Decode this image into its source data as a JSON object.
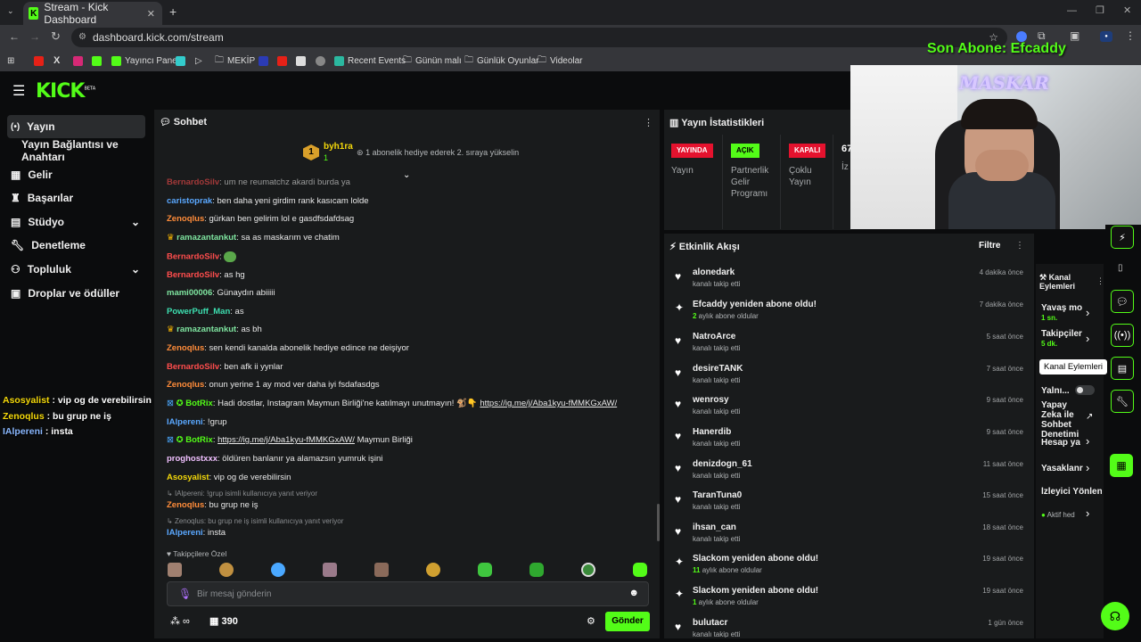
{
  "browser": {
    "tab_title": "Stream - Kick Dashboard",
    "url": "dashboard.kick.com/stream",
    "bookmarks": [
      "Yayıncı Paneli",
      "MEKİP",
      "Recent Events",
      "Günün malı",
      "Günlük Oyunlar",
      "Videolar"
    ]
  },
  "overlay": {
    "last_sub": "Son Abone: Efcaddy",
    "cam_name": "MASKAR",
    "chat": [
      {
        "user": "Asosyalist",
        "msg": " : vip og de verebilirsin"
      },
      {
        "user": "Zenoqlus",
        "msg": " : bu grup ne iş"
      },
      {
        "user": "IAlpereni",
        "msg": " : insta"
      }
    ]
  },
  "brand": {
    "logo": "KICK",
    "beta": "BETA"
  },
  "sidebar": {
    "items": [
      {
        "label": "Yayın"
      },
      {
        "label": "Yayın Bağlantısı ve Anahtarı"
      },
      {
        "label": "Gelir"
      },
      {
        "label": "Başarılar"
      },
      {
        "label": "Stüdyo"
      },
      {
        "label": "Denetleme"
      },
      {
        "label": "Topluluk"
      },
      {
        "label": "Droplar ve ödüller"
      }
    ]
  },
  "chat": {
    "title": "Sohbet",
    "top_user": "byh1ra",
    "top_rank": "1",
    "top_count": "1",
    "promo": "1 abonelik hediye ederek 2. sıraya yükselin",
    "cut_top": {
      "user": "BernardoSilv",
      "msg": ": um ne reumatchz akardi burda ya"
    },
    "messages": [
      {
        "user": "caristoprak",
        "msg": ": ben daha yeni girdim rank kasıcam lolde"
      },
      {
        "user": "Zenoqlus",
        "msg": ": gürkan ben gelirim lol e gasdfsdafdsag"
      },
      {
        "user": "ramazantankut",
        "msg": ": sa as maskarım ve chatim"
      },
      {
        "user": "BernardoSilv",
        "msg": ": "
      },
      {
        "user": "BernardoSilv",
        "msg": ": as hg"
      },
      {
        "user": "mami00006",
        "msg": ": Günaydın abiiiii"
      },
      {
        "user": "PowerPuff_Man",
        "msg": ": as"
      },
      {
        "user": "ramazantankut",
        "msg": ": as bh"
      },
      {
        "user": "Zenoqlus",
        "msg": ": sen kendi kanalda abonelik hediye edince ne deişiyor"
      },
      {
        "user": "BernardoSilv",
        "msg": ": ben afk ii yynlar"
      },
      {
        "user": "Zenoqlus",
        "msg": ": onun yerine 1 ay mod ver daha iyi fsdafasdgs"
      },
      {
        "user": "BotRix",
        "msg": ": Hadi dostlar, Instagram Maymun Birliği'ne katılmayı unutmayın! 🐒👇 ",
        "link": "https://ig.me/j/Aba1kyu-fMMKGxAW/"
      },
      {
        "user": "IAlpereni",
        "msg": ": !grup"
      },
      {
        "user": "BotRix",
        "msg": ": ",
        "link": "https://ig.me/j/Aba1kyu-fMMKGxAW/",
        "after": " Maymun Birliği"
      },
      {
        "user": "proghostxxx",
        "msg": ": öldüren banlanır ya alamazsın yumruk işini"
      },
      {
        "user": "Asosyalist",
        "msg": ": vip og de verebilirsin"
      },
      {
        "reply": "IAlpereni: !grup isimli kullanıcıya yanıt veriyor",
        "user": "Zenoqlus",
        "msg": ": bu grup ne iş"
      },
      {
        "reply": "Zenoqlus: bu grup ne iş isimli kullanıcıya yanıt veriyor",
        "user": "IAlpereni",
        "msg": ": insta"
      }
    ],
    "emote_section": "Takipçilere Özel",
    "input_placeholder": "Bir mesaj gönderin",
    "points_value": "390",
    "send_label": "Gönder"
  },
  "stats": {
    "title": "Yayın İstatistikleri",
    "items": [
      {
        "badge": "YAYINDA",
        "label": "Yayın",
        "color": "#e5122e"
      },
      {
        "badge": "AÇIK",
        "label": "Partnerlik Gelir Programı",
        "color": "#53fc18"
      },
      {
        "badge": "KAPALI",
        "label": "Çoklu Yayın",
        "color": "#e5122e"
      }
    ],
    "partial_value": "67",
    "partial_label": "İz"
  },
  "events": {
    "title": "Etkinlik Akışı",
    "filter": "Filtre",
    "items": [
      {
        "name": "alonedark",
        "sub": "kanalı takip etti",
        "time": "4 dakika önce",
        "type": "follow"
      },
      {
        "name": "Efcaddy yeniden abone oldu!",
        "sub_n": "2",
        "sub": " aylık abone oldular",
        "time": "7 dakika önce",
        "type": "sub"
      },
      {
        "name": "NatroArce",
        "sub": "kanalı takip etti",
        "time": "5 saat önce",
        "type": "follow"
      },
      {
        "name": "desireTANK",
        "sub": "kanalı takip etti",
        "time": "7 saat önce",
        "type": "follow"
      },
      {
        "name": "wenrosy",
        "sub": "kanalı takip etti",
        "time": "9 saat önce",
        "type": "follow"
      },
      {
        "name": "Hanerdib",
        "sub": "kanalı takip etti",
        "time": "9 saat önce",
        "type": "follow"
      },
      {
        "name": "denizdogn_61",
        "sub": "kanalı takip etti",
        "time": "11 saat önce",
        "type": "follow"
      },
      {
        "name": "TaranTuna0",
        "sub": "kanalı takip etti",
        "time": "15 saat önce",
        "type": "follow"
      },
      {
        "name": "ihsan_can",
        "sub": "kanalı takip etti",
        "time": "18 saat önce",
        "type": "follow"
      },
      {
        "name": "Slackom yeniden abone oldu!",
        "sub_n": "11",
        "sub": " aylık abone oldular",
        "time": "19 saat önce",
        "type": "sub"
      },
      {
        "name": "Slackom yeniden abone oldu!",
        "sub_n": "1",
        "sub": " aylık abone oldular",
        "time": "19 saat önce",
        "type": "sub"
      },
      {
        "name": "bulutacr",
        "sub": "kanalı takip etti",
        "time": "1 gün önce",
        "type": "follow"
      }
    ]
  },
  "channel_actions": {
    "title": "Kanal Eylemleri",
    "tooltip": "Kanal Eylemleri",
    "items": [
      {
        "label": "Yavaş mo",
        "sub": "1 sn."
      },
      {
        "label": "Takipçiler",
        "sub": "5 dk."
      },
      {
        "label": "Yalnı..."
      },
      {
        "label": "Yapay Zeka ile Sohbet Denetimi"
      },
      {
        "label": "Hesap ya"
      },
      {
        "label": "Yasaklanr"
      },
      {
        "label": "İzleyici Yönlenc"
      },
      {
        "label": "Aktif hed"
      }
    ]
  },
  "colors": {
    "accent": "#53fc18",
    "live_red": "#e5122e"
  }
}
